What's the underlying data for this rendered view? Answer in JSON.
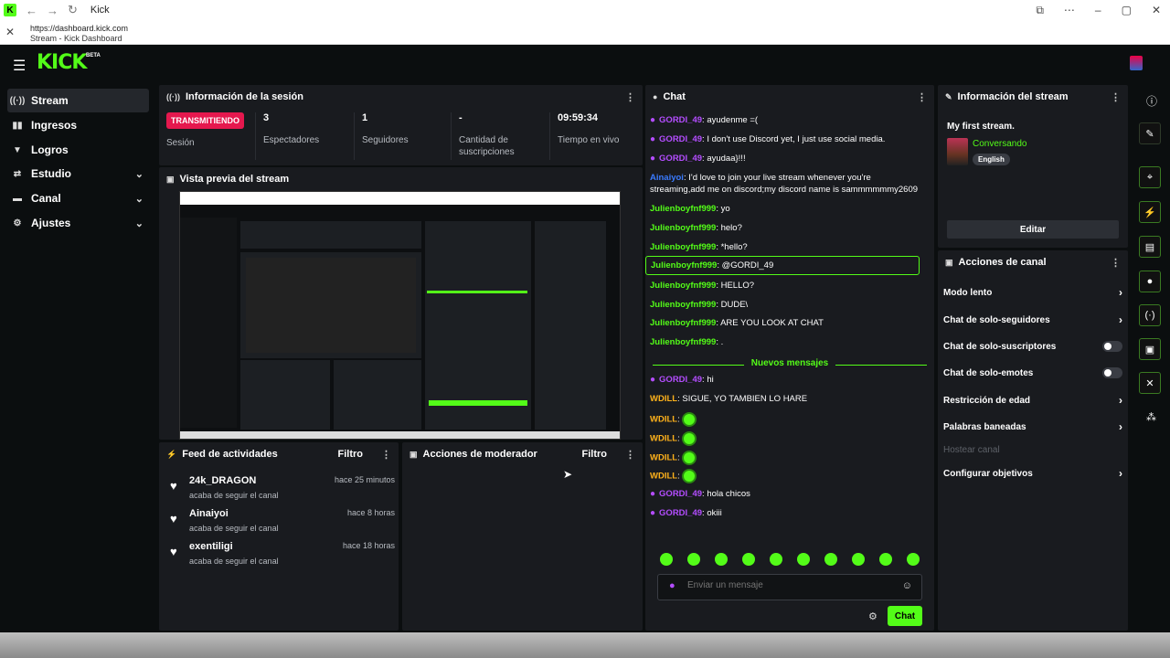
{
  "window": {
    "title": "Kick",
    "url": "https://dashboard.kick.com",
    "tab_title": "Stream - Kick Dashboard"
  },
  "brand": {
    "logo": "KICK",
    "beta": "BETA",
    "accent": "#53fc18"
  },
  "sidebar": {
    "items": [
      {
        "label": "Stream",
        "icon": "stream-icon"
      },
      {
        "label": "Ingresos",
        "icon": "revenue-icon"
      },
      {
        "label": "Logros",
        "icon": "trophy-icon"
      },
      {
        "label": "Estudio",
        "icon": "studio-icon"
      },
      {
        "label": "Canal",
        "icon": "channel-icon"
      },
      {
        "label": "Ajustes",
        "icon": "gear-icon"
      }
    ]
  },
  "session": {
    "title": "Información de la sesión",
    "badge": "TRANSMITIENDO",
    "badge_label": "Sesión",
    "stats": [
      {
        "value": "3",
        "label": "Espectadores"
      },
      {
        "value": "1",
        "label": "Seguidores"
      },
      {
        "value": "-",
        "label": "Cantidad de suscripciones"
      },
      {
        "value": "09:59:34",
        "label": "Tiempo en vivo"
      }
    ]
  },
  "preview": {
    "title": "Vista previa del stream"
  },
  "activity": {
    "title": "Feed de actividades",
    "filter": "Filtro",
    "items": [
      {
        "name": "24k_DRAGON",
        "sub": "acaba de seguir el canal",
        "time": "hace 25 minutos"
      },
      {
        "name": "Ainaiyoi",
        "sub": "acaba de seguir el canal",
        "time": "hace 8 horas"
      },
      {
        "name": "exentiligi",
        "sub": "acaba de seguir el canal",
        "time": "hace 18 horas"
      }
    ]
  },
  "moderator": {
    "title": "Acciones de moderador",
    "filter": "Filtro"
  },
  "chat": {
    "title": "Chat",
    "messages": [
      {
        "user": "GORDI_49",
        "text": "ayudenme =(",
        "color": "#b44dff",
        "mic": true
      },
      {
        "user": "GORDI_49",
        "text": "I don't use Discord yet, I just use social media.",
        "color": "#b44dff",
        "mic": true
      },
      {
        "user": "GORDI_49",
        "text": "ayudaa}!!!",
        "color": "#b44dff",
        "mic": true
      },
      {
        "user": "Ainaiyoi",
        "text": "I'd love to join your live stream whenever you're streaming,add me on discord;my discord name is sammmmmmy2609",
        "color": "#3a7bff",
        "mic": false
      },
      {
        "user": "Julienboyfnf999",
        "text": "yo",
        "color": "#53fc18",
        "mic": false
      },
      {
        "user": "Julienboyfnf999",
        "text": "helo?",
        "color": "#53fc18",
        "mic": false
      },
      {
        "user": "Julienboyfnf999",
        "text": "*hello?",
        "color": "#53fc18",
        "mic": false
      },
      {
        "user": "Julienboyfnf999",
        "text": "@GORDI_49",
        "color": "#53fc18",
        "mic": false
      },
      {
        "user": "Julienboyfnf999",
        "text": "HELLO?",
        "color": "#53fc18",
        "mic": false
      },
      {
        "user": "Julienboyfnf999",
        "text": "DUDE\\",
        "color": "#53fc18",
        "mic": false
      },
      {
        "user": "Julienboyfnf999",
        "text": "ARE YOU LOOK AT CHAT",
        "color": "#53fc18",
        "mic": false
      },
      {
        "user": "Julienboyfnf999",
        "text": ".",
        "color": "#53fc18",
        "mic": false
      }
    ],
    "new_messages_label": "Nuevos mensajes",
    "new_messages": [
      {
        "user": "GORDI_49",
        "text": "hi",
        "color": "#b44dff",
        "mic": true
      },
      {
        "user": "WDILL",
        "text": "SIGUE, YO TAMBIEN LO HARE",
        "color": "#ffb21b",
        "mic": false
      },
      {
        "user": "WDILL",
        "text": "",
        "color": "#ffb21b",
        "mic": false,
        "emote": true
      },
      {
        "user": "WDILL",
        "text": "",
        "color": "#ffb21b",
        "mic": false,
        "emote": true
      },
      {
        "user": "WDILL",
        "text": "",
        "color": "#ffb21b",
        "mic": false,
        "emote": true
      },
      {
        "user": "WDILL",
        "text": "",
        "color": "#ffb21b",
        "mic": false,
        "emote": true
      },
      {
        "user": "GORDI_49",
        "text": "hola chicos",
        "color": "#b44dff",
        "mic": true
      },
      {
        "user": "GORDI_49",
        "text": "okiii",
        "color": "#b44dff",
        "mic": true
      }
    ],
    "input_placeholder": "Enviar un mensaje",
    "send_label": "Chat"
  },
  "stream_info": {
    "title": "Información del stream",
    "stream_title": "My first stream.",
    "category": "Conversando",
    "language": "English",
    "edit_label": "Editar"
  },
  "channel_actions": {
    "title": "Acciones de canal",
    "items": [
      {
        "label": "Modo lento",
        "type": "chevron"
      },
      {
        "label": "Chat de solo-seguidores",
        "type": "chevron"
      },
      {
        "label": "Chat de solo-suscriptores",
        "type": "toggle"
      },
      {
        "label": "Chat de solo-emotes",
        "type": "toggle"
      },
      {
        "label": "Restricción de edad",
        "type": "chevron"
      },
      {
        "label": "Palabras baneadas",
        "type": "chevron"
      },
      {
        "label": "Hostear canal",
        "type": "disabled"
      },
      {
        "label": "Configurar objetivos",
        "type": "chevron"
      }
    ]
  }
}
